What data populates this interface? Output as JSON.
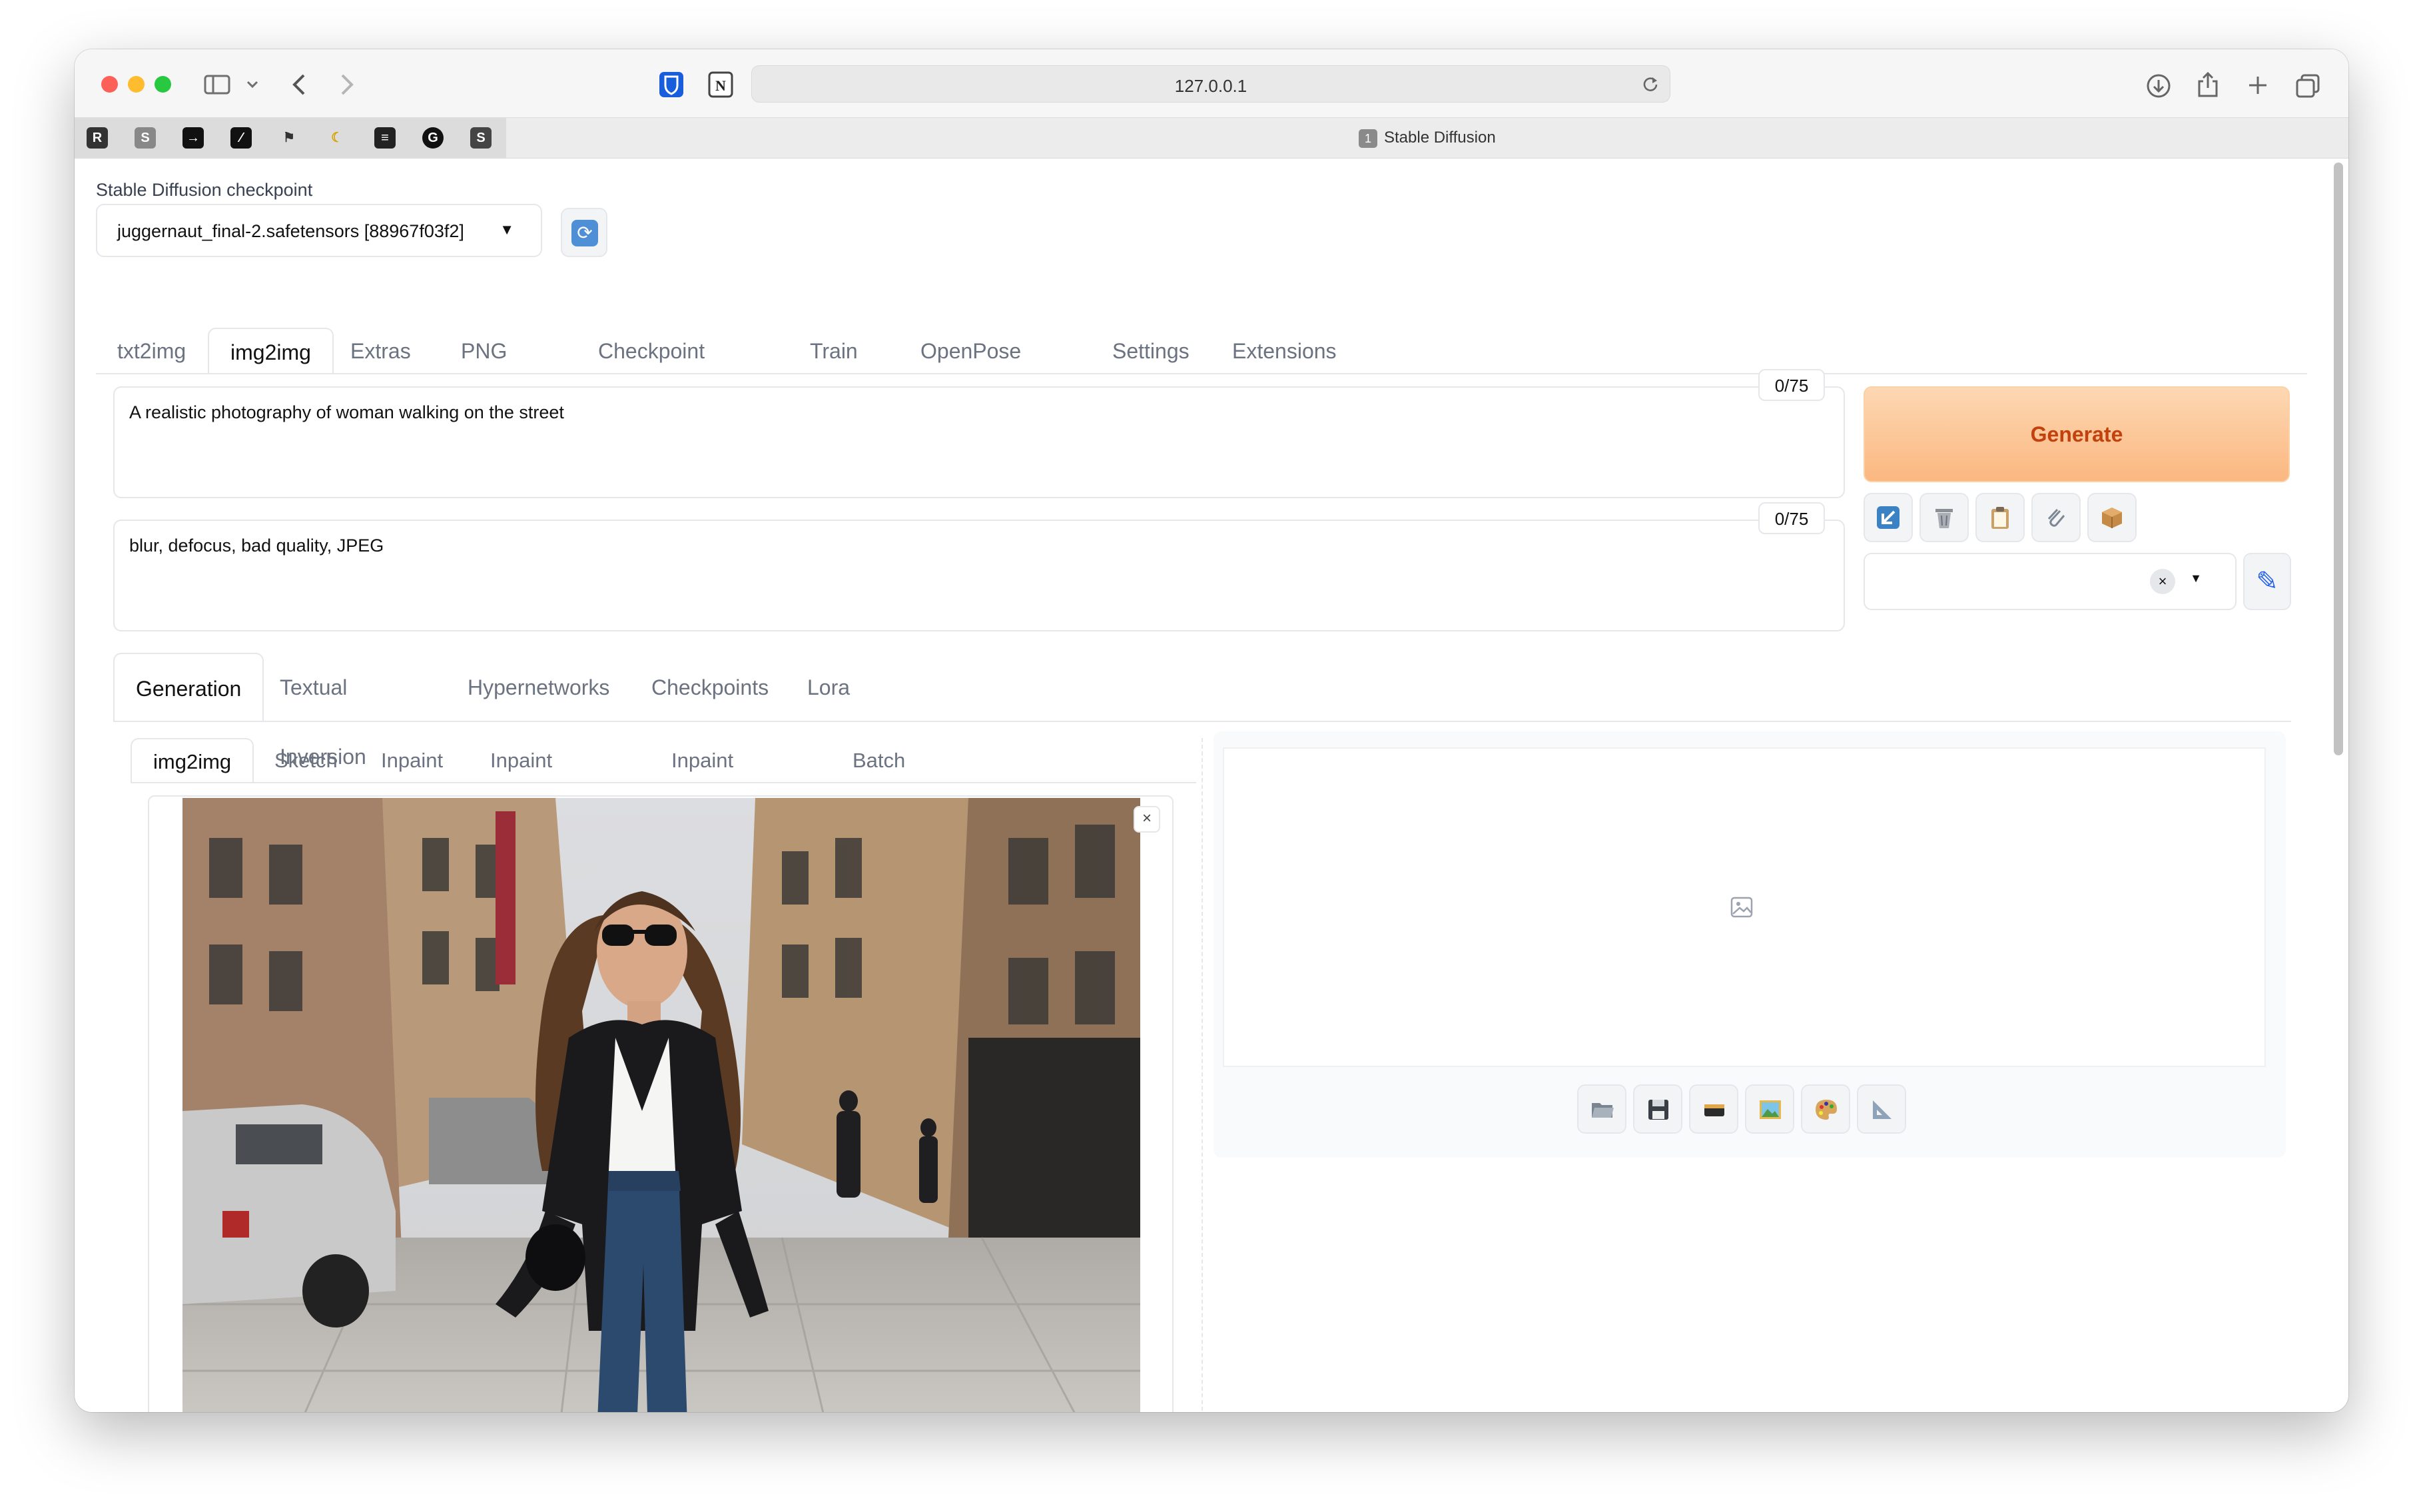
{
  "browser": {
    "url": "127.0.0.1",
    "tab_number": "1",
    "tab_title": "Stable Diffusion",
    "bookmark_icons": [
      "R",
      "S",
      "arrow",
      "slash",
      "flag",
      "banana",
      "list",
      "G",
      "S"
    ]
  },
  "checkpoint": {
    "label": "Stable Diffusion checkpoint",
    "value": "juggernaut_final-2.safetensors [88967f03f2]"
  },
  "main_tabs": [
    "txt2img",
    "img2img",
    "Extras",
    "PNG Info",
    "Checkpoint Merger",
    "Train",
    "OpenPose Editor",
    "Settings",
    "Extensions"
  ],
  "active_main_tab": "img2img",
  "prompt": {
    "text": "A realistic photography of woman walking on the street",
    "counter": "0/75"
  },
  "negative_prompt": {
    "text": "blur, defocus, bad quality, JPEG",
    "counter": "0/75"
  },
  "generate_label": "Generate",
  "tool_buttons": [
    "arrow-up-left-icon",
    "trash-icon",
    "clipboard-icon",
    "paperclip-icon",
    "package-icon"
  ],
  "sub_tabs": [
    "Generation",
    "Textual Inversion",
    "Hypernetworks",
    "Checkpoints",
    "Lora"
  ],
  "image_tabs": [
    "img2img",
    "Sketch",
    "Inpaint",
    "Inpaint sketch",
    "Inpaint upload",
    "Batch"
  ],
  "output_buttons": [
    "folder-icon",
    "save-icon",
    "zip-icon",
    "image-icon",
    "palette-icon",
    "ruler-icon"
  ],
  "colors": {
    "generate_bg": "#fbb780",
    "generate_text": "#c2410c",
    "accent_blue": "#2563eb"
  }
}
